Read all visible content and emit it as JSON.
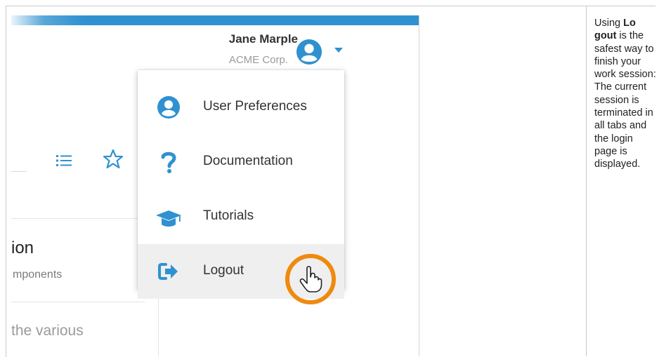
{
  "header": {
    "user_name": "Jane Marple",
    "company": "ACME Corp.",
    "accent_color": "#2f91d0"
  },
  "user_menu": {
    "items": [
      {
        "label": "User Preferences",
        "icon": "user-circle-icon",
        "active": false
      },
      {
        "label": "Documentation",
        "icon": "question-mark-icon",
        "active": false
      },
      {
        "label": "Tutorials",
        "icon": "graduation-cap-icon",
        "active": false
      },
      {
        "label": "Logout",
        "icon": "logout-icon",
        "active": true
      }
    ],
    "highlight_color": "#ef8a0e"
  },
  "background": {
    "partial_title": "ion",
    "partial_subtitle": "mponents",
    "partial_body": "the various"
  },
  "note": {
    "prefix": "Using ",
    "bold": "Logout",
    "bold_display": "Lo\ngout",
    "text": " is the safest way to finish your work session: The current session is terminated in all tabs and the login page is displayed."
  }
}
